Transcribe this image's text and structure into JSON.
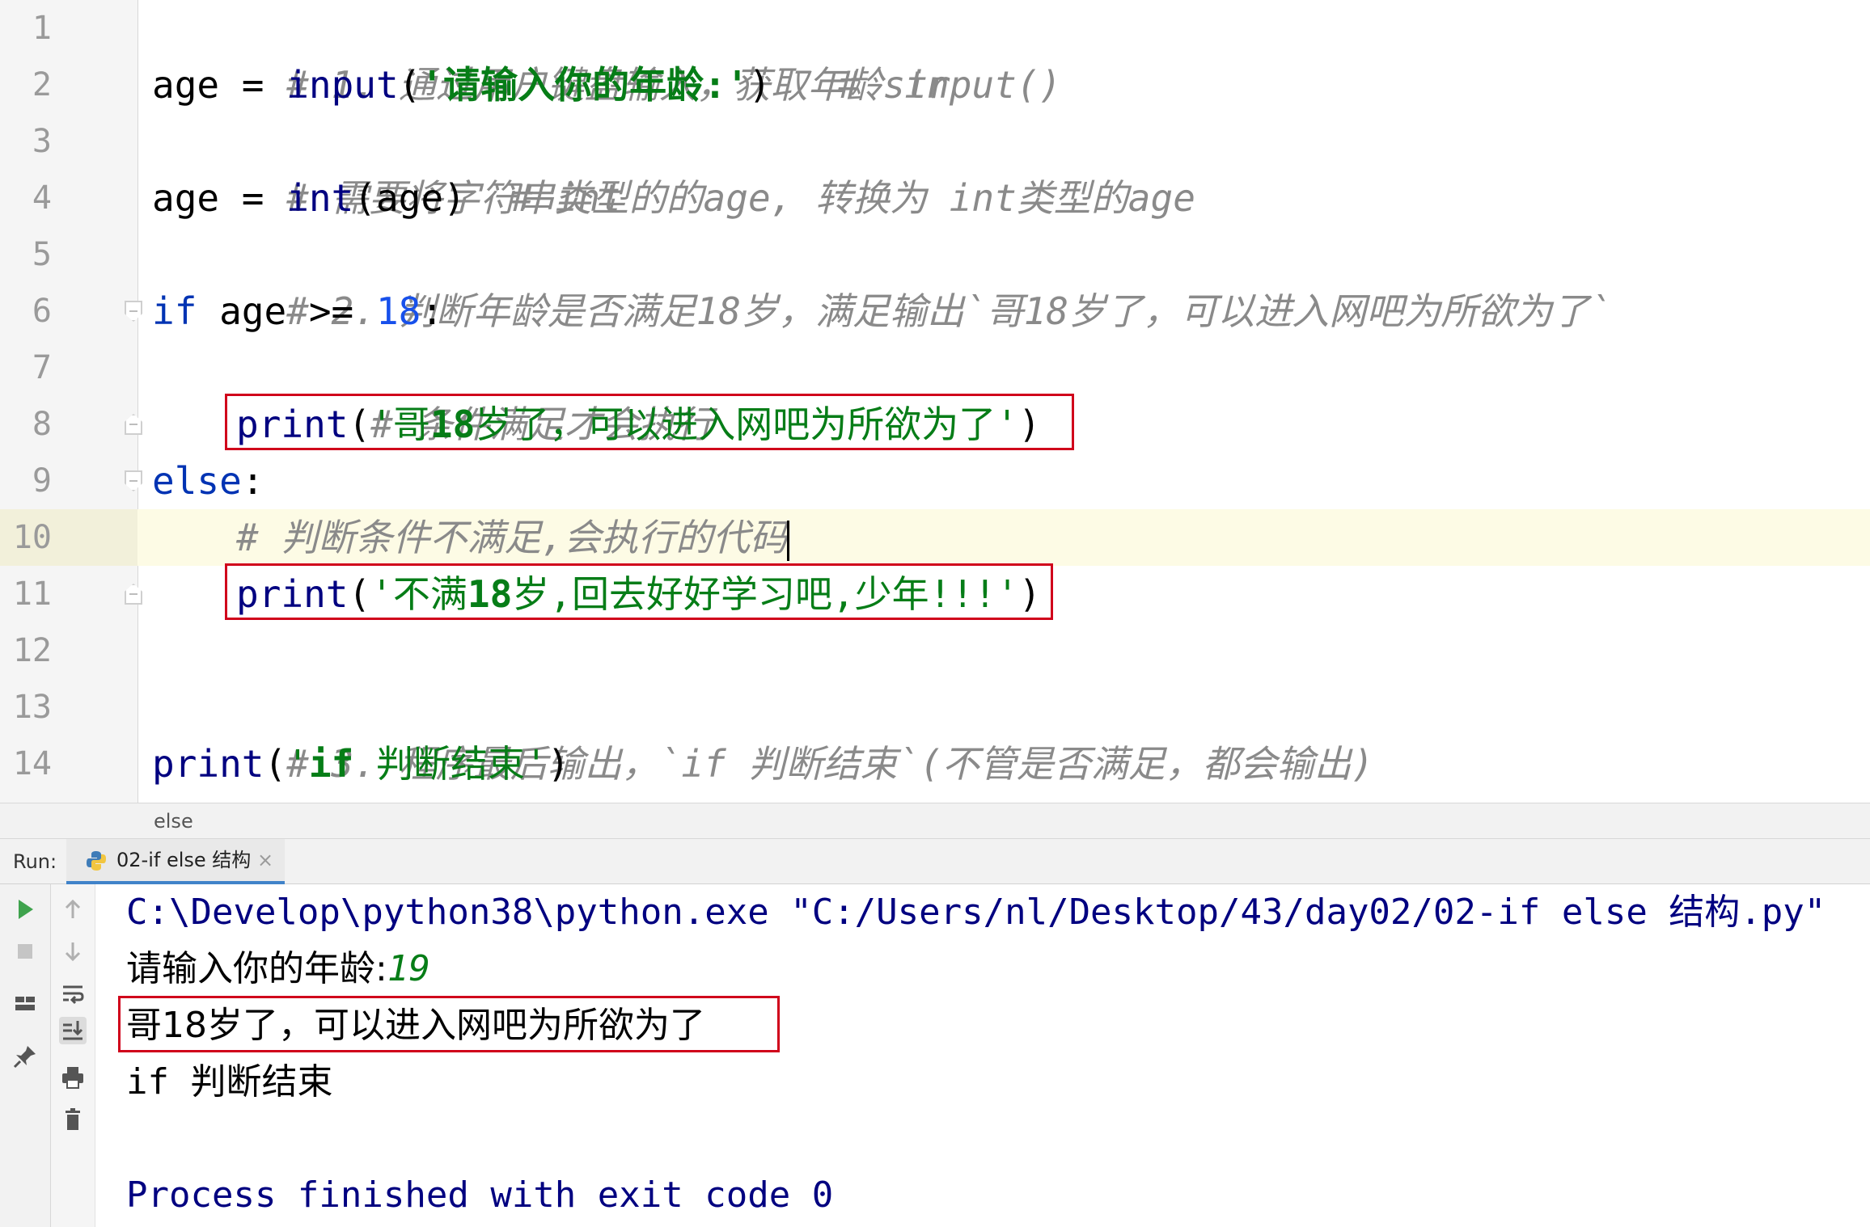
{
  "editor": {
    "current_line": 10,
    "lines": [
      {
        "n": "1",
        "comment": "# 1. 通过用户键盘输入，获取年龄 input()"
      },
      {
        "n": "2",
        "var": "age",
        "op": " = ",
        "func": "input",
        "open": "(",
        "str": "'请输入你的年龄:'",
        "close": ")",
        "gap": "   ",
        "comment": "# str"
      },
      {
        "n": "3",
        "comment": "# 需要将字符串类型的的age, 转换为 int类型的age"
      },
      {
        "n": "4",
        "var": "age",
        "op": " = ",
        "func": "int",
        "args": "(age)",
        "gap": "  ",
        "comment": "# int"
      },
      {
        "n": "5",
        "comment": "# 2. 判断年龄是否满足18岁，满足输出`哥18岁了，可以进入网吧为所欲为了`"
      },
      {
        "n": "6",
        "kw": "if",
        "rest": " age >= ",
        "num": "18",
        "colon": ":"
      },
      {
        "n": "7",
        "comment": "# 条件满足才会执行"
      },
      {
        "n": "8",
        "func": "print",
        "open": "(",
        "str_a": "'哥",
        "str_b": "18",
        "str_c": "岁了，可以进入网吧为所欲为了'",
        "close": ")"
      },
      {
        "n": "9",
        "kw": "else",
        "colon": ":"
      },
      {
        "n": "10",
        "comment": "# 判断条件不满足,会执行的代码"
      },
      {
        "n": "11",
        "func": "print",
        "open": "(",
        "str_a": "'不满",
        "str_b": "18",
        "str_c": "岁,回去好好学习吧,少年!!!'",
        "close": ")"
      },
      {
        "n": "12"
      },
      {
        "n": "13",
        "comment": "# 3. 程序最后输出，`if 判断结束`(不管是否满足，都会输出)"
      },
      {
        "n": "14",
        "func": "print",
        "open": "(",
        "str_a": "'",
        "str_b": "if",
        "str_c": " 判断结束'",
        "close": ")"
      }
    ]
  },
  "breadcrumb": "else",
  "run": {
    "label": "Run:",
    "tab_label": "02-if else 结构",
    "tab_close": "×",
    "output": {
      "cmd": "C:\\Develop\\python38\\python.exe \"C:/Users/nl/Desktop/43/day02/02-if else 结构.py\"",
      "prompt": "请输入你的年龄:",
      "user_input": "19",
      "result": "哥18岁了，可以进入网吧为所欲为了",
      "final": "if 判断结束",
      "exit": "Process finished with exit code 0"
    }
  },
  "icons": {
    "run": "play-icon",
    "stop": "stop-icon",
    "layout": "layout-icon",
    "pin": "pin-icon",
    "up": "arrow-up-icon",
    "down": "arrow-down-icon",
    "wrap": "soft-wrap-icon",
    "scroll": "scroll-to-end-icon",
    "print": "print-icon",
    "trash": "trash-icon",
    "python": "python-icon"
  },
  "colors": {
    "highlight_box": "#d0021b",
    "keyword": "#0033b3",
    "string": "#067d17",
    "number": "#1750eb",
    "comment": "#8a8a8a",
    "console_text": "#000080"
  }
}
